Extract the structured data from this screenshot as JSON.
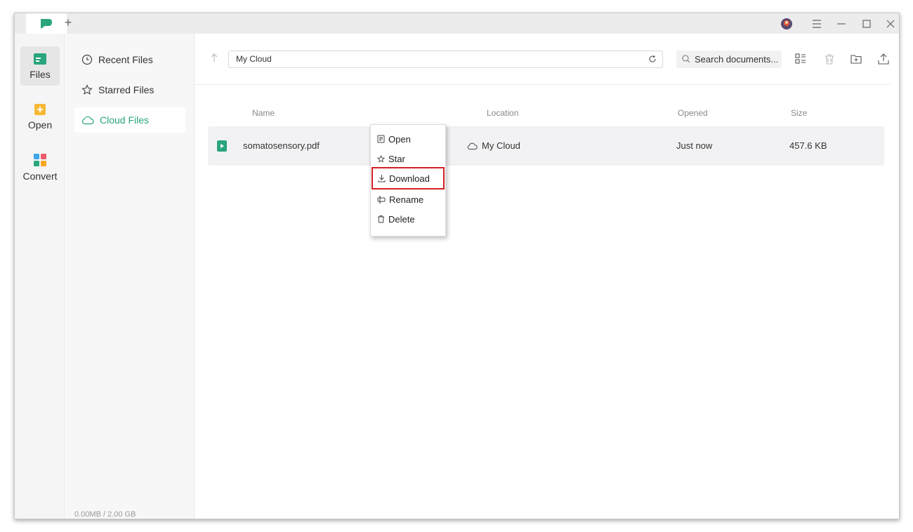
{
  "titlebar": {
    "add_tab_label": "+"
  },
  "rail": {
    "items": [
      {
        "label": "Files",
        "icon": "files-icon",
        "active": true
      },
      {
        "label": "Open",
        "icon": "open-icon",
        "active": false
      },
      {
        "label": "Convert",
        "icon": "convert-icon",
        "active": false
      }
    ]
  },
  "sidebar": {
    "items": [
      {
        "label": "Recent Files",
        "icon": "clock-icon"
      },
      {
        "label": "Starred Files",
        "icon": "star-icon"
      },
      {
        "label": "Cloud Files",
        "icon": "cloud-icon",
        "active": true
      }
    ],
    "storage": "0.00MB  / 2.00 GB"
  },
  "toolbar": {
    "path": "My Cloud",
    "search_placeholder": "Search documents..."
  },
  "table": {
    "headers": {
      "name": "Name",
      "location": "Location",
      "opened": "Opened",
      "size": "Size"
    },
    "rows": [
      {
        "name": "somatosensory.pdf",
        "location": "My Cloud",
        "opened": "Just now",
        "size": "457.6 KB"
      }
    ]
  },
  "context_menu": {
    "items": [
      {
        "label": "Open",
        "icon": "open-file-icon"
      },
      {
        "label": "Star",
        "icon": "star-icon"
      },
      {
        "label": "Download",
        "icon": "download-icon",
        "highlighted": true
      },
      {
        "label": "Rename",
        "icon": "rename-icon"
      },
      {
        "label": "Delete",
        "icon": "trash-icon"
      }
    ]
  },
  "colors": {
    "accent": "#2aa57d",
    "highlight_border": "#d41f25"
  }
}
